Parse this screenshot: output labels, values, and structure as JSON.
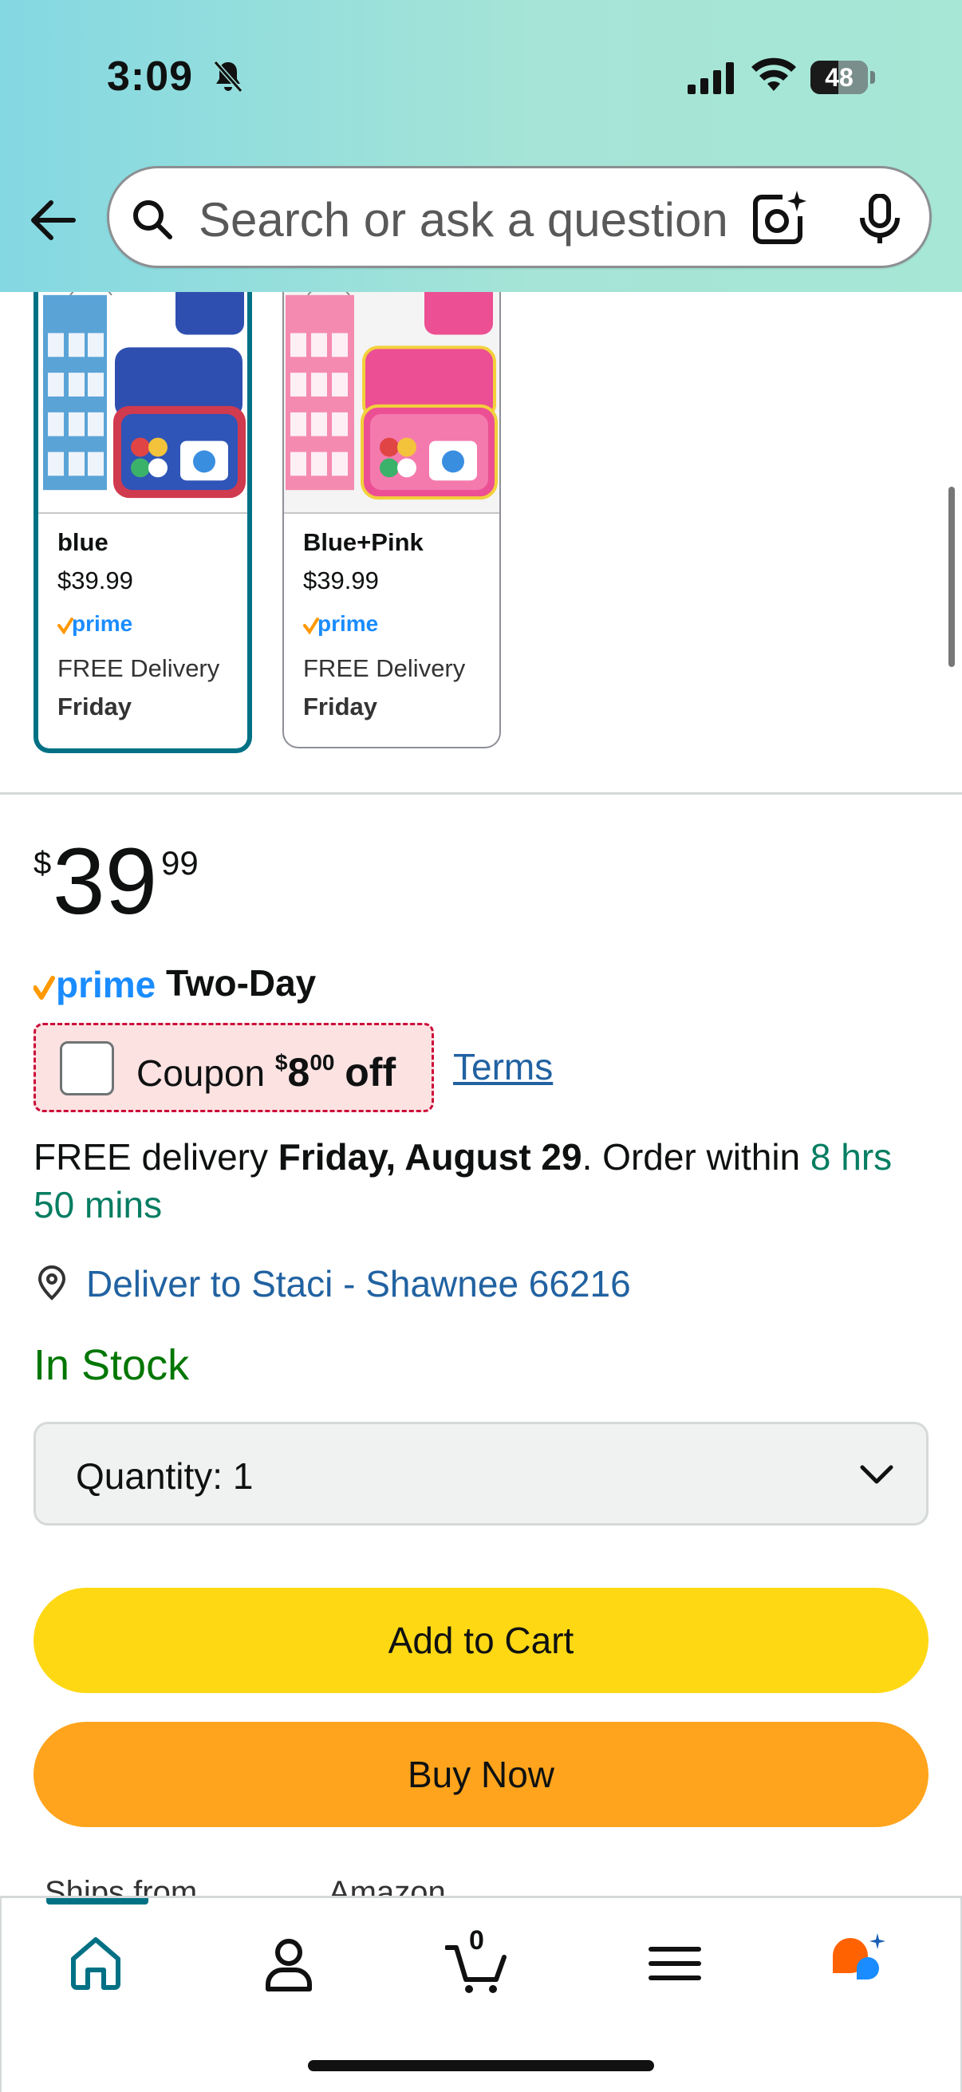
{
  "status_bar": {
    "time": "3:09",
    "battery": "48",
    "battery_level_percent": 48
  },
  "search": {
    "placeholder": "Search or ask a question"
  },
  "variants": [
    {
      "name": "blue",
      "price": "$39.99",
      "prime": "prime",
      "delivery": "FREE Delivery",
      "day": "Friday",
      "selected": true
    },
    {
      "name": "Blue+Pink",
      "price": "$39.99",
      "prime": "prime",
      "delivery": "FREE Delivery",
      "day": "Friday",
      "selected": false
    }
  ],
  "price": {
    "symbol": "$",
    "whole": "39",
    "fraction": "99"
  },
  "prime_badge": {
    "prime": "prime",
    "label": "Two-Day"
  },
  "coupon": {
    "label": "Coupon",
    "symbol": "$",
    "amount": "8",
    "cents": "00",
    "off": "off",
    "terms": "Terms"
  },
  "delivery": {
    "prefix": "FREE delivery",
    "date": "Friday, August 29",
    "middle": ". Order within",
    "countdown": "8 hrs 50 mins"
  },
  "deliver_to": "Deliver to Staci - Shawnee 66216",
  "stock_status": "In Stock",
  "quantity": {
    "label": "Quantity:",
    "value": "1"
  },
  "buttons": {
    "add_to_cart": "Add to Cart",
    "buy_now": "Buy Now"
  },
  "ships_from": {
    "label": "Ships from",
    "value": "Amazon"
  },
  "bottom_nav": {
    "cart_count": "0"
  },
  "colors": {
    "accent_teal": "#007185",
    "add_to_cart": "#ffd814",
    "buy_now": "#ffa41c",
    "in_stock": "#007600",
    "link": "#2162a1",
    "coupon_bg": "#fde2e2"
  }
}
